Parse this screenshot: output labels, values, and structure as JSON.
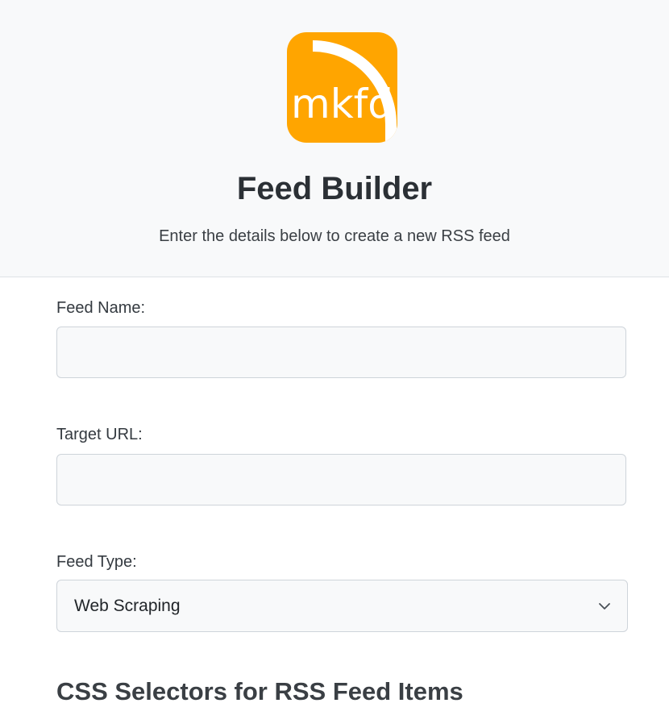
{
  "header": {
    "logo_text": "mkfd",
    "title": "Feed Builder",
    "subtitle": "Enter the details below to create a new RSS feed"
  },
  "form": {
    "feed_name": {
      "label": "Feed Name:",
      "value": ""
    },
    "target_url": {
      "label": "Target URL:",
      "value": ""
    },
    "feed_type": {
      "label": "Feed Type:",
      "selected": "Web Scraping"
    }
  },
  "section": {
    "selectors_heading": "CSS Selectors for RSS Feed Items"
  },
  "colors": {
    "logo_orange": "#ffa500",
    "header_bg": "#f8f9fa"
  }
}
